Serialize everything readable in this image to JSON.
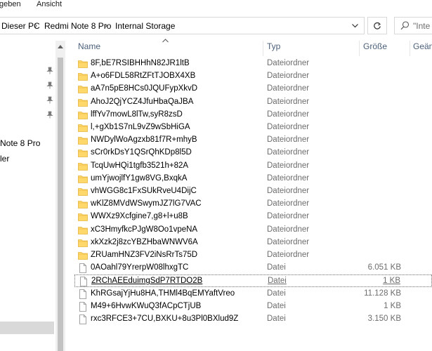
{
  "ribbon": {
    "tabs": [
      "geben",
      "Ansicht"
    ]
  },
  "address": {
    "breadcrumbs": [
      "Dieser PC",
      "Redmi Note 8 Pro",
      "Internal Storage"
    ],
    "search_placeholder": "\"Inte"
  },
  "nav": {
    "items": [
      "Note 8 Pro",
      "ler"
    ]
  },
  "columns": {
    "name": "Name",
    "type": "Typ",
    "size": "Größe",
    "changed": "Geänd"
  },
  "files": [
    {
      "name": "8F,bE7RSIBHHhN82JR1ltB",
      "type": "Dateiordner",
      "size": "",
      "kind": "folder"
    },
    {
      "name": "A+o6FDL58RtZFtTJOBX4XB",
      "type": "Dateiordner",
      "size": "",
      "kind": "folder"
    },
    {
      "name": "aA7n5pE8HCs0JQUFypXkvD",
      "type": "Dateiordner",
      "size": "",
      "kind": "folder"
    },
    {
      "name": "AhoJ2QjYCZ4JfuHbaQaJBA",
      "type": "Dateiordner",
      "size": "",
      "kind": "folder"
    },
    {
      "name": "lffYv7mowL8lTw,syR8zsD",
      "type": "Dateiordner",
      "size": "",
      "kind": "folder"
    },
    {
      "name": "l,+gXb1S7nL9vZ9wSbHiGA",
      "type": "Dateiordner",
      "size": "",
      "kind": "folder"
    },
    {
      "name": "NWDylWoAgzxb81f7R+mhyB",
      "type": "Dateiordner",
      "size": "",
      "kind": "folder"
    },
    {
      "name": "sCr0rkDsY1QSrQhKDp8l5D",
      "type": "Dateiordner",
      "size": "",
      "kind": "folder"
    },
    {
      "name": "TcqUwHQi1tgfb3521h+82A",
      "type": "Dateiordner",
      "size": "",
      "kind": "folder"
    },
    {
      "name": "umYjwojlfY1gw8VG,BxqkA",
      "type": "Dateiordner",
      "size": "",
      "kind": "folder"
    },
    {
      "name": "vhWGG8c1FxSUkRveU4DijC",
      "type": "Dateiordner",
      "size": "",
      "kind": "folder"
    },
    {
      "name": "wKlZ8MVdWSwymJZ7lG7VAC",
      "type": "Dateiordner",
      "size": "",
      "kind": "folder"
    },
    {
      "name": "WWXz9Xcfgine7,g8+l+u8B",
      "type": "Dateiordner",
      "size": "",
      "kind": "folder"
    },
    {
      "name": "xC3HmyfkcPJgW8Oo1vpeNA",
      "type": "Dateiordner",
      "size": "",
      "kind": "folder"
    },
    {
      "name": "xkXzk2j8zcYBZHbaWNWV6A",
      "type": "Dateiordner",
      "size": "",
      "kind": "folder"
    },
    {
      "name": "ZRUamHNZ3FV2iNsRrTs75D",
      "type": "Dateiordner",
      "size": "",
      "kind": "folder"
    },
    {
      "name": "0AOahl79YrerpW08lhxgTC",
      "type": "Datei",
      "size": "6.051 KB",
      "kind": "file"
    },
    {
      "name": "2RChAEEduimgSdP7RTDO2B",
      "type": "Datei",
      "size": "1 KB",
      "kind": "file",
      "selected": true
    },
    {
      "name": "KhRGsajYjHu8HA,THMl4BqEMYaftVreo",
      "type": "Datei",
      "size": "11.128 KB",
      "kind": "file"
    },
    {
      "name": "M49+6HvwKWuQ3fACpCTjUB",
      "type": "Datei",
      "size": "1 KB",
      "kind": "file"
    },
    {
      "name": "rxc3RFCE3+7CU,BXKU+8u3Pl0BXlud9Z",
      "type": "Datei",
      "size": "3.150 KB",
      "kind": "file"
    }
  ],
  "colors": {
    "folder": "#ffd86b",
    "folder_dark": "#e6b43c",
    "header_text": "#4c607a",
    "border": "#d9d9d9"
  }
}
